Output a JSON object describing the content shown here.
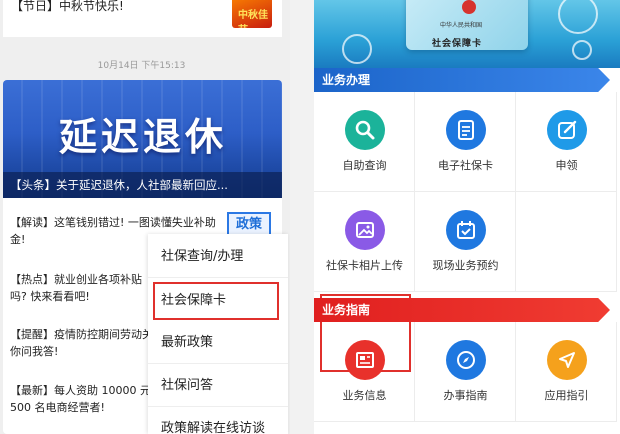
{
  "left_feed": {
    "top_card_text": "【节日】中秋节快乐!",
    "top_card_thumb_text": "中秋佳节",
    "timestamp": "10月14日 下午15:13",
    "hero_title": "延迟退休",
    "hero_caption": "【头条】关于延迟退休，人社部最新回应...",
    "news": [
      {
        "line1": "【解读】这笔钱别错过! 一图读懂失业补助",
        "line2": "金!"
      },
      {
        "line1": "【热点】就业创业各项补贴",
        "line2": "吗? 快来看看吧!"
      },
      {
        "line1": "【提醒】疫情防控期间劳动关",
        "line2": "你问我答!"
      },
      {
        "line1": "【最新】每人资助 10000 元",
        "line2": "500 名电商经营者!"
      }
    ],
    "tag_label": "政策"
  },
  "popup_menu": {
    "items": [
      "社保查询/办理",
      "社会保障卡",
      "最新政策",
      "社保问答",
      "政策解读在线访谈"
    ],
    "selected_index": 1
  },
  "right_panel": {
    "banner_line1": "中华人民共和国",
    "banner_line2": "社会保障卡",
    "section1_title": "业务办理",
    "section1_items": [
      "自助查询",
      "电子社保卡",
      "申领",
      "社保卡相片上传",
      "现场业务预约"
    ],
    "section2_title": "业务指南",
    "section2_items": [
      "业务信息",
      "办事指南",
      "应用指引"
    ],
    "colors": {
      "teal": "#1bb39a",
      "blue": "#1f78e0",
      "purple": "#8a5ae6",
      "red": "#e8312b",
      "orange": "#f5a11c",
      "section_blue": "#1b64c9",
      "section_red": "#e01f1f",
      "highlight": "#e0302c"
    }
  }
}
